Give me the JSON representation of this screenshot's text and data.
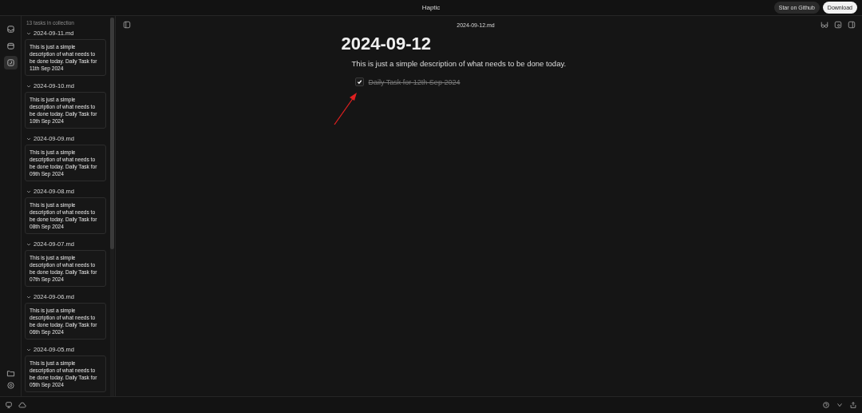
{
  "window": {
    "title": "Haptic"
  },
  "header_buttons": [
    {
      "label": "Star on Github",
      "kind": "secondary"
    },
    {
      "label": "Download",
      "kind": "primary"
    }
  ],
  "rail": [
    {
      "kind": "inbox",
      "selected": false
    },
    {
      "kind": "calendar",
      "selected": false
    },
    {
      "kind": "tasks",
      "selected": true
    }
  ],
  "sidebar": {
    "summary": "13 tasks in collection",
    "groups": [
      {
        "file": "2024-09-11.md",
        "expanded": true,
        "task": "This is just a simple description of what needs to be done today. Daily Task for 11th Sep 2024"
      },
      {
        "file": "2024-09-10.md",
        "expanded": true,
        "task": "This is just a simple description of what needs to be done today. Daily Task for 10th Sep 2024"
      },
      {
        "file": "2024-09-09.md",
        "expanded": true,
        "task": "This is just a simple description of what needs to be done today. Daily Task for 09th Sep 2024"
      },
      {
        "file": "2024-09-08.md",
        "expanded": true,
        "task": "This is just a simple description of what needs to be done today. Daily Task for 08th Sep 2024"
      },
      {
        "file": "2024-09-07.md",
        "expanded": true,
        "task": "This is just a simple description of what needs to be done today. Daily Task for 07th Sep 2024"
      },
      {
        "file": "2024-09-06.md",
        "expanded": true,
        "task": "This is just a simple description of what needs to be done today. Daily Task for 06th Sep 2024"
      },
      {
        "file": "2024-09-05.md",
        "expanded": true,
        "task": "This is just a simple description of what needs to be done today. Daily Task for 05th Sep 2024"
      }
    ]
  },
  "document": {
    "filename": "2024-09-12.md",
    "title": "2024-09-12",
    "description": "This is just a simple description of what needs to be done today.",
    "tasks": [
      {
        "label": "Daily Task for 12th Sep 2024",
        "checked": true
      }
    ]
  }
}
